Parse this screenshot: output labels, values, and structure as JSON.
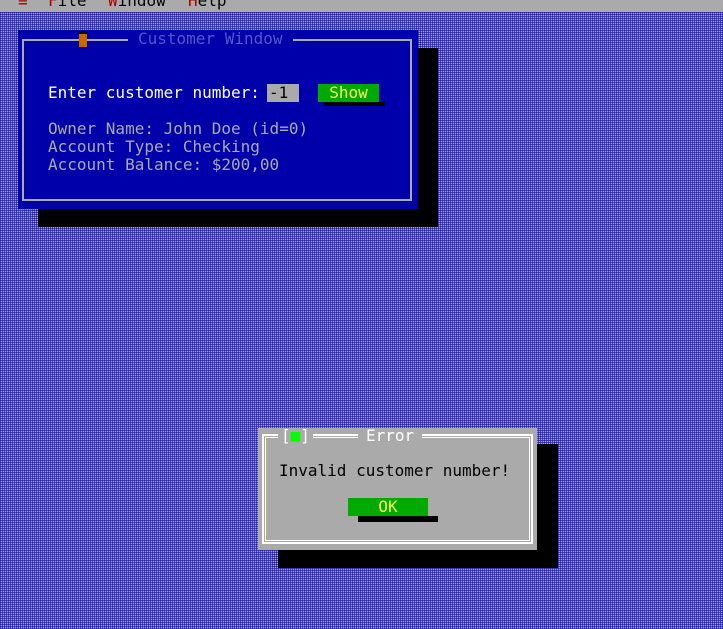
{
  "menubar": {
    "system_label": "≡",
    "file_label": "File",
    "file_hot": "F",
    "file_rest": "ile",
    "window_label": "Window",
    "window_hot": "W",
    "window_rest": "indow",
    "help_label": "Help",
    "help_hot": "H",
    "help_rest": "elp"
  },
  "customer_window": {
    "title": "Customer Window",
    "prompt": "Enter customer number:",
    "customer_number": "-1",
    "show_label": "Show",
    "owner_line": "Owner Name: John Doe (id=0)",
    "account_type_line": "Account Type: Checking",
    "balance_line": "Account Balance: $200,00"
  },
  "error_dialog": {
    "title": "Error",
    "close_open": "[",
    "close_mark": "■",
    "close_close": "]",
    "message": "Invalid customer number!",
    "ok_label": "OK"
  },
  "colors": {
    "desktop": "#0000aa",
    "window_bg": "#0000aa",
    "dialog_bg": "#aaaaaa",
    "button_bg": "#00aa00",
    "button_text": "#ffff55",
    "hotkey": "#aa0000"
  }
}
